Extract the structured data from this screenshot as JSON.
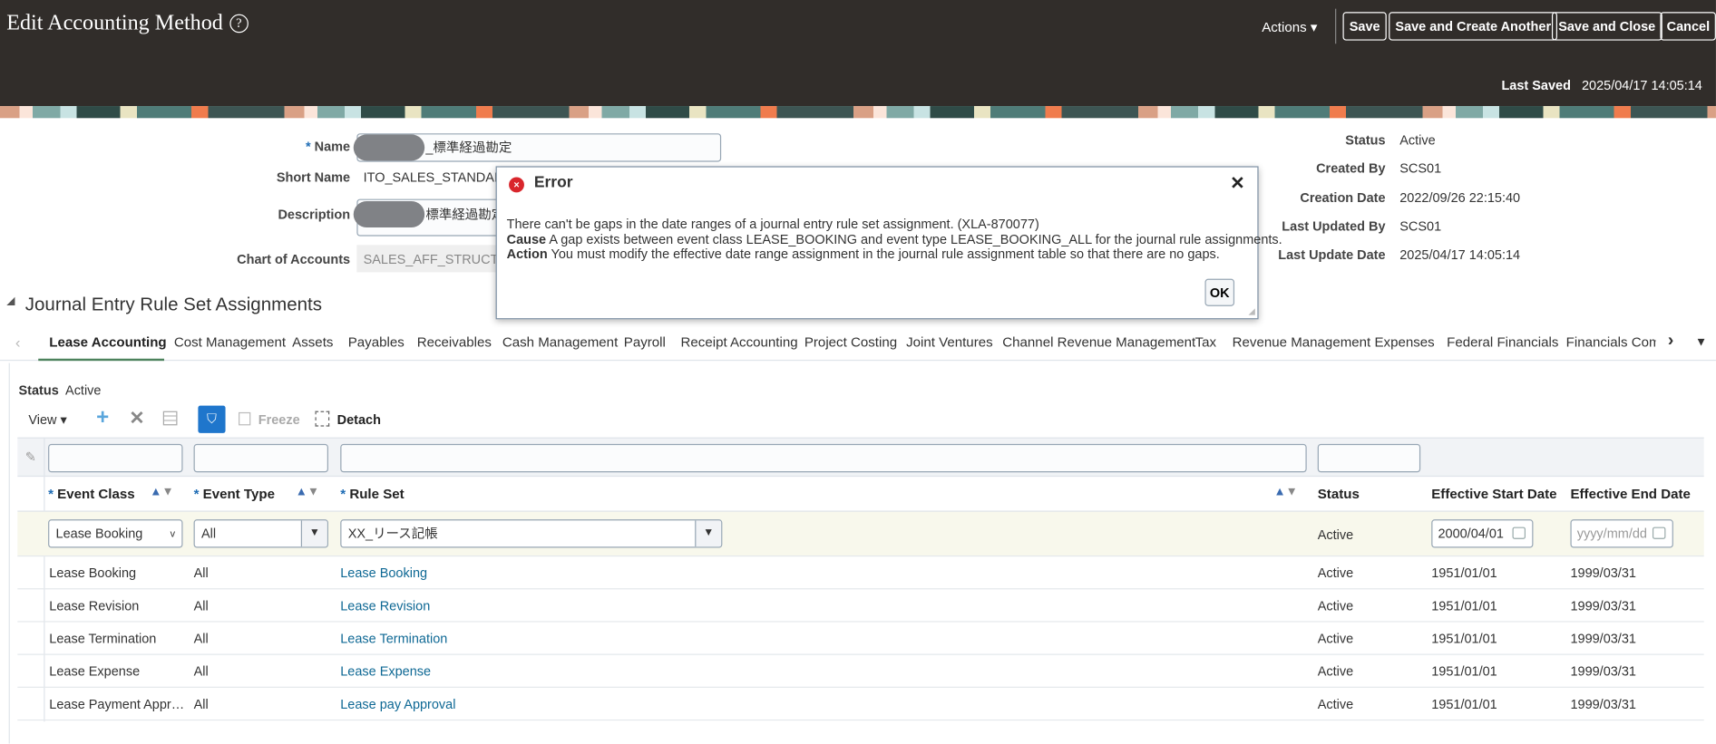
{
  "header": {
    "title": "Edit Accounting Method",
    "actions": "Actions",
    "save": "Save",
    "save_create": "Save and Create Another",
    "save_close": "Save and Close",
    "cancel": "Cancel",
    "last_saved_label": "Last Saved",
    "last_saved_value": "2025/04/17 14:05:14"
  },
  "form": {
    "name_label": "Name",
    "name_value": "_標準経過勘定",
    "short_name_label": "Short Name",
    "short_name_value": "ITO_SALES_STANDAR",
    "description_label": "Description",
    "description_value": "標準経過勘定",
    "coa_label": "Chart of Accounts",
    "coa_value": "SALES_AFF_STRUCTU",
    "status_label": "Status",
    "status_value": "Active",
    "created_by_label": "Created By",
    "created_by_value": "SCS01",
    "creation_date_label": "Creation Date",
    "creation_date_value": "2022/09/26 22:15:40",
    "last_updated_by_label": "Last Updated By",
    "last_updated_by_value": "SCS01",
    "last_update_date_label": "Last Update Date",
    "last_update_date_value": "2025/04/17 14:05:14"
  },
  "dialog": {
    "title": "Error",
    "message": "There can't be gaps in the date ranges of a journal entry rule set assignment. (XLA-870077)",
    "cause_label": "Cause",
    "cause": "A gap exists between event class LEASE_BOOKING and event type LEASE_BOOKING_ALL for the journal rule assignments.",
    "action_label": "Action",
    "action": "You must modify the effective date range assignment in the journal rule assignment table so that there are no gaps.",
    "ok": "OK"
  },
  "section": {
    "title": "Journal Entry Rule Set Assignments"
  },
  "tabs": [
    "Lease Accounting",
    "Cost Management",
    "Assets",
    "Payables",
    "Receivables",
    "Cash Management",
    "Payroll",
    "Receipt Accounting",
    "Project Costing",
    "Joint Ventures",
    "Channel Revenue Management",
    "Tax",
    "Revenue Management",
    "Expenses",
    "Federal Financials",
    "Financials Comr"
  ],
  "panel": {
    "status_label": "Status",
    "status_value": "Active",
    "view": "View",
    "freeze": "Freeze",
    "detach": "Detach"
  },
  "table": {
    "columns": [
      "Event Class",
      "Event Type",
      "Rule Set",
      "Status",
      "Effective Start Date",
      "Effective End Date"
    ],
    "edit_row": {
      "event_class": "Lease Booking",
      "event_type": "All",
      "rule_set": "XX_リース記帳",
      "status": "Active",
      "start": "2000/04/01",
      "end_placeholder": "yyyy/mm/dd"
    },
    "rows": [
      {
        "event_class": "Lease Booking",
        "event_type": "All",
        "rule_set": "Lease Booking",
        "status": "Active",
        "start": "1951/01/01",
        "end": "1999/03/31"
      },
      {
        "event_class": "Lease Revision",
        "event_type": "All",
        "rule_set": "Lease Revision",
        "status": "Active",
        "start": "1951/01/01",
        "end": "1999/03/31"
      },
      {
        "event_class": "Lease Termination",
        "event_type": "All",
        "rule_set": "Lease Termination",
        "status": "Active",
        "start": "1951/01/01",
        "end": "1999/03/31"
      },
      {
        "event_class": "Lease Expense",
        "event_type": "All",
        "rule_set": "Lease Expense",
        "status": "Active",
        "start": "1951/01/01",
        "end": "1999/03/31"
      },
      {
        "event_class": "Lease Payment Appr…",
        "event_type": "All",
        "rule_set": "Lease pay Approval",
        "status": "Active",
        "start": "1951/01/01",
        "end": "1999/03/31"
      }
    ]
  }
}
